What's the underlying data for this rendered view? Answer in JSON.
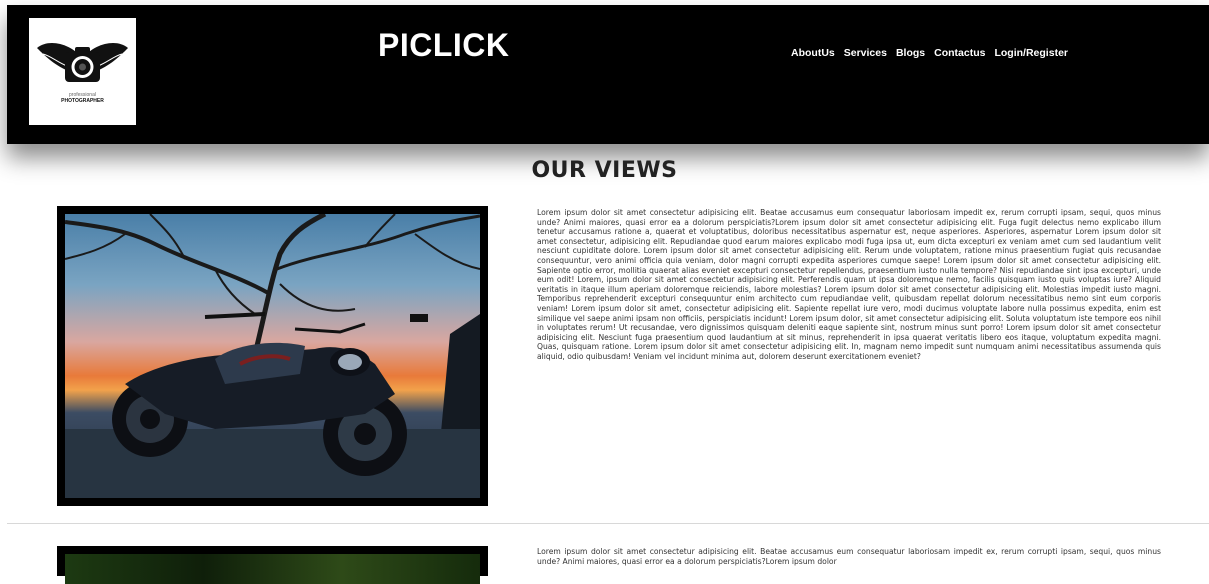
{
  "header": {
    "brand": "PICLICK",
    "logo": {
      "icon": "camera-wings-logo",
      "line1": "professional",
      "line2": "PHOTOGRAPHER"
    },
    "nav": [
      "AboutUs",
      "Services",
      "Blogs",
      "Contactus",
      "Login/Register"
    ]
  },
  "main": {
    "title": "OUR VIEWS",
    "posts": [
      {
        "image": "motorcycle-sunset-photo",
        "text": "Lorem ipsum dolor sit amet consectetur adipisicing elit. Beatae accusamus eum consequatur laboriosam impedit ex, rerum corrupti ipsam, sequi, quos minus unde? Animi maiores, quasi error ea a dolorum perspiciatis?Lorem ipsum dolor sit amet consectetur adipisicing elit. Fuga fugit delectus nemo explicabo illum tenetur accusamus ratione a, quaerat et voluptatibus, doloribus necessitatibus aspernatur est, neque asperiores. Asperiores, aspernatur Lorem ipsum dolor sit amet consectetur, adipisicing elit. Repudiandae quod earum maiores explicabo modi fuga ipsa ut, eum dicta excepturi ex veniam amet cum sed laudantium velit nesciunt cupiditate dolore. Lorem ipsum dolor sit amet consectetur adipisicing elit. Rerum unde voluptatem, ratione minus praesentium fugiat quis recusandae consequuntur, vero animi officia quia veniam, dolor magni corrupti expedita asperiores cumque saepe! Lorem ipsum dolor sit amet consectetur adipisicing elit. Sapiente optio error, mollitia quaerat alias eveniet excepturi consectetur repellendus, praesentium iusto nulla tempore? Nisi repudiandae sint ipsa excepturi, unde eum odit! Lorem, ipsum dolor sit amet consectetur adipisicing elit. Perferendis quam ut ipsa doloremque nemo, facilis quisquam iusto quis voluptas iure? Aliquid veritatis in itaque illum aperiam doloremque reiciendis, labore molestias? Lorem ipsum dolor sit amet consectetur adipisicing elit. Molestias impedit iusto magni. Temporibus reprehenderit excepturi consequuntur enim architecto cum repudiandae velit, quibusdam repellat dolorum necessitatibus nemo sint eum corporis veniam! Lorem ipsum dolor sit amet, consectetur adipisicing elit. Sapiente repellat iure vero, modi ducimus voluptate labore nulla possimus expedita, enim est similique vel saepe animi ipsam non officiis, perspiciatis incidunt! Lorem ipsum dolor, sit amet consectetur adipisicing elit. Soluta voluptatum iste tempore eos nihil in voluptates rerum! Ut recusandae, vero dignissimos quisquam deleniti eaque sapiente sint, nostrum minus sunt porro! Lorem ipsum dolor sit amet consectetur adipisicing elit. Nesciunt fuga praesentium quod laudantium at sit minus, reprehenderit in ipsa quaerat veritatis libero eos itaque, voluptatum expedita magni. Quas, quisquam ratione. Lorem ipsum dolor sit amet consectetur adipisicing elit. In, magnam nemo impedit sunt numquam animi necessitatibus assumenda quis aliquid, odio quibusdam! Veniam vel incidunt minima aut, dolorem deserunt exercitationem eveniet?"
      },
      {
        "image": "green-photo",
        "text": "Lorem ipsum dolor sit amet consectetur adipisicing elit. Beatae accusamus eum consequatur laboriosam impedit ex, rerum corrupti ipsam, sequi, quos minus unde? Animi maiores, quasi error ea a dolorum perspiciatis?Lorem ipsum dolor"
      }
    ]
  },
  "colors": {
    "header_bg": "#000000",
    "header_text": "#ffffff",
    "body_text": "#333333"
  }
}
